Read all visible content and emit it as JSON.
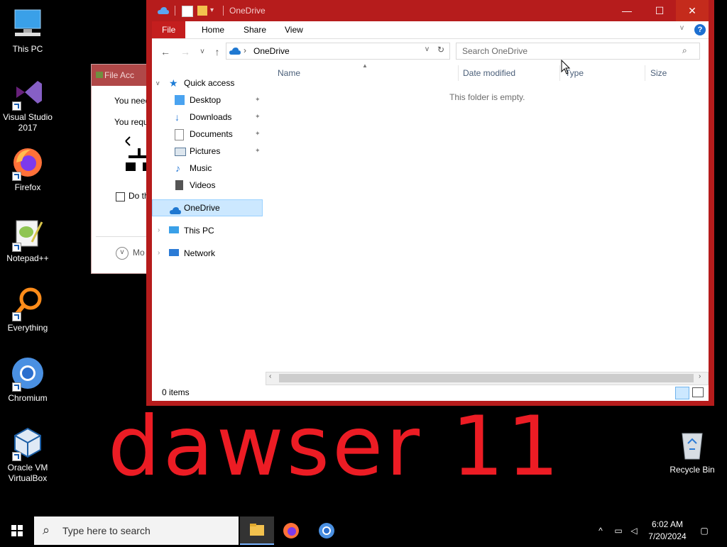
{
  "desktop": {
    "icons": [
      {
        "label": "This PC"
      },
      {
        "label": "Visual Studio\n2017"
      },
      {
        "label": "Firefox"
      },
      {
        "label": "Notepad++"
      },
      {
        "label": "Everything"
      },
      {
        "label": "Chromium"
      },
      {
        "label": "Oracle VM\nVirtualBox"
      },
      {
        "label": "Recycle Bin"
      }
    ]
  },
  "bg_dialog": {
    "title": "File Acc",
    "line1": "You need",
    "line2": "You requ",
    "checkbox": "Do th",
    "more": "Mo"
  },
  "explorer": {
    "title": "OneDrive",
    "ribbon_tabs": [
      "File",
      "Home",
      "Share",
      "View"
    ],
    "address": {
      "crumb": "OneDrive"
    },
    "search_placeholder": "Search OneDrive",
    "nav": {
      "quick_access": "Quick access",
      "items": [
        "Desktop",
        "Downloads",
        "Documents",
        "Pictures",
        "Music",
        "Videos"
      ],
      "onedrive": "OneDrive",
      "this_pc": "This PC",
      "network": "Network"
    },
    "columns": [
      "Name",
      "Date modified",
      "Type",
      "Size"
    ],
    "empty_message": "This folder is empty.",
    "status": "0 items"
  },
  "overlay_text": "dawser 11",
  "taskbar": {
    "search_placeholder": "Type here to search",
    "time": "6:02 AM",
    "date": "7/20/2024"
  },
  "colors": {
    "window_frame": "#b61c1c",
    "file_tab": "#c41e1e",
    "overlay": "#ec1c24",
    "selection": "#cce8ff"
  },
  "icons": [
    "this-pc-icon",
    "visual-studio-icon",
    "firefox-icon",
    "notepadpp-icon",
    "everything-icon",
    "chromium-icon",
    "virtualbox-icon",
    "recycle-bin-icon",
    "onedrive-icon",
    "start-icon",
    "search-icon",
    "file-explorer-icon"
  ]
}
